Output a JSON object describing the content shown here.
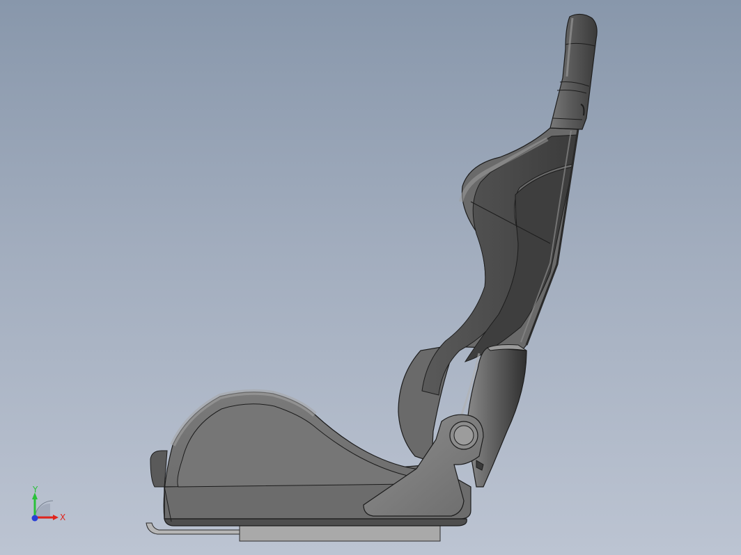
{
  "viewport": {
    "background_top": "#8897ab",
    "background_bottom": "#bcc4d2"
  },
  "model": {
    "name": "racing-bucket-seat",
    "view": "side",
    "shell_color": "#6f6f6f",
    "highlight_color": "#9a9a9a",
    "dark_color": "#3f3f3f",
    "edge_color": "#1c1c1c",
    "rail_color": "#a8a8a8"
  },
  "triad": {
    "x_label": "X",
    "y_label": "Y",
    "x_color": "#e0241c",
    "y_color": "#2ac13a",
    "z_color": "#2a3fd6"
  }
}
